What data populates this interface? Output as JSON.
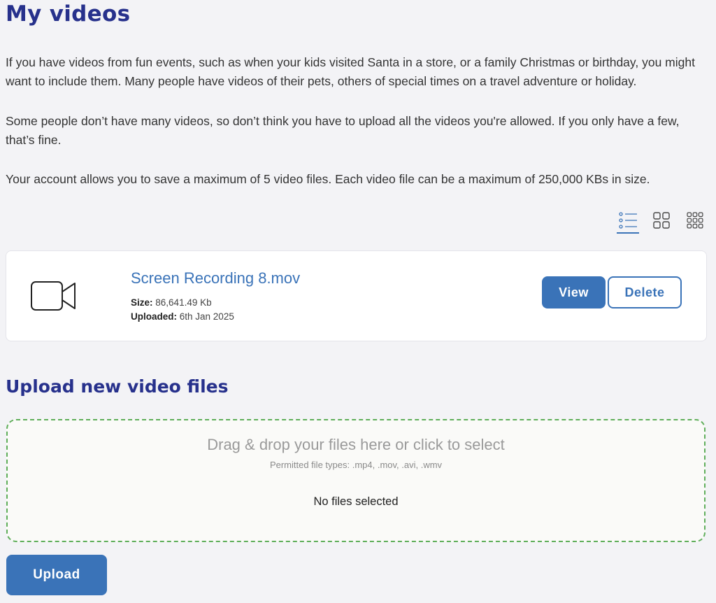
{
  "page": {
    "title": "My videos",
    "intro_paragraphs": [
      "If you have videos from fun events, such as when your kids visited Santa in a store, or a family Christmas or birthday, you might want to include them. Many people have videos of their pets, others of special times on a travel adventure or holiday.",
      "Some people don’t have many videos, so don’t think you have to upload all the videos you're allowed. If you only have a few, that’s fine.",
      "Your account allows you to save a maximum of 5 video files. Each video file can be a maximum of 250,000 KBs in size."
    ]
  },
  "view_toggles": [
    {
      "icon": "list-view-icon",
      "active": true
    },
    {
      "icon": "grid-view-icon",
      "active": false
    },
    {
      "icon": "small-grid-view-icon",
      "active": false
    }
  ],
  "videos": [
    {
      "icon": "video-camera-icon",
      "file_name": "Screen Recording 8.mov",
      "size_label": "Size:",
      "size_value": "86,641.49 Kb",
      "uploaded_label": "Uploaded:",
      "uploaded_value": "6th Jan 2025",
      "view_label": "View",
      "delete_label": "Delete"
    }
  ],
  "upload": {
    "heading": "Upload new video files",
    "dropzone_text": "Drag & drop your files here or click to select",
    "permitted_types": "Permitted file types: .mp4, .mov, .avi, .wmv",
    "status": "No files selected",
    "button_label": "Upload"
  },
  "colors": {
    "heading": "#27318c",
    "accent": "#3a73b8",
    "dropzone_border": "#5fae5a",
    "background": "#f3f3f6"
  }
}
